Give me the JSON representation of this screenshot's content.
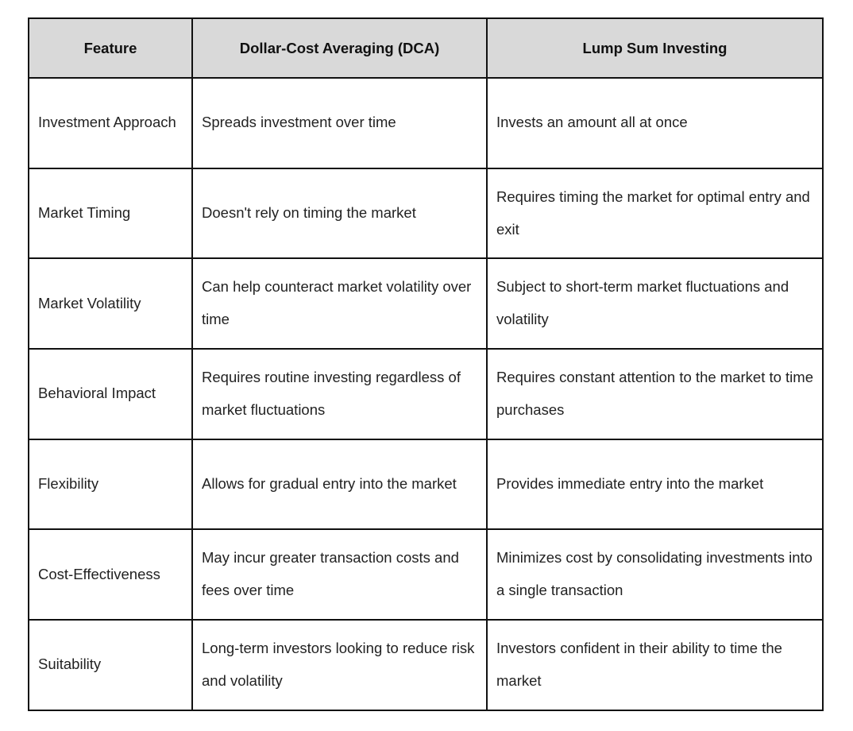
{
  "table": {
    "headers": [
      "Feature",
      "Dollar-Cost Averaging (DCA)",
      "Lump Sum Investing"
    ],
    "rows": [
      [
        "Investment Approach",
        "Spreads investment over time",
        "Invests an amount all at once"
      ],
      [
        "Market Timing",
        "Doesn't rely on timing the market",
        "Requires timing the market for optimal entry and exit"
      ],
      [
        "Market Volatility",
        "Can help counteract market volatility over time",
        "Subject to short-term market fluctuations and volatility"
      ],
      [
        "Behavioral Impact",
        "Requires routine investing regardless of market fluctuations",
        "Requires constant attention to the market to time purchases"
      ],
      [
        "Flexibility",
        "Allows for gradual entry into the market",
        "Provides immediate entry into the market"
      ],
      [
        "Cost-Effectiveness",
        "May incur greater transaction costs and fees over time",
        "Minimizes cost by consolidating investments into a single transaction"
      ],
      [
        "Suitability",
        "Long-term investors looking to reduce risk and volatility",
        "Investors confident in their ability to time the market"
      ]
    ]
  },
  "colors": {
    "header_background": "#d9d9d9",
    "border": "#111111",
    "text": "#222222"
  }
}
